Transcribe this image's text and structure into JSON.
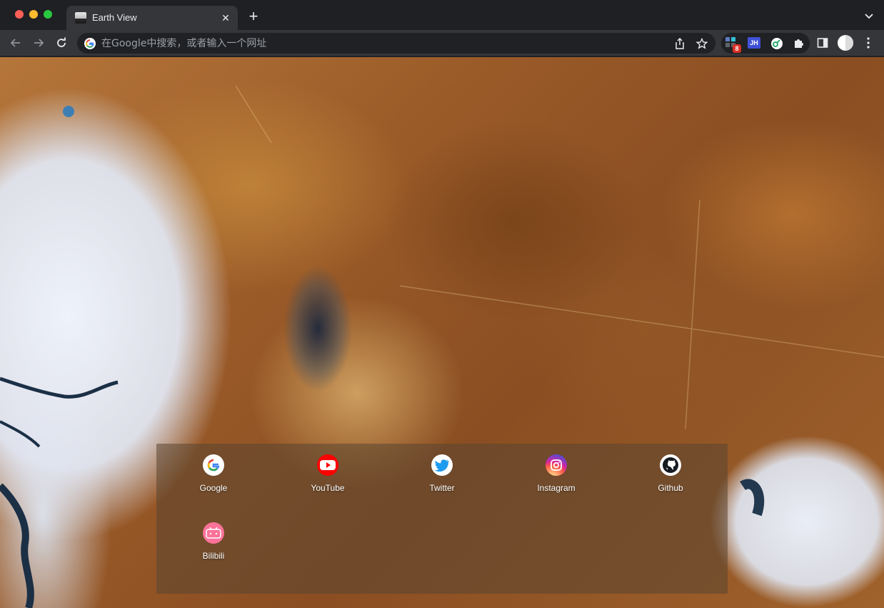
{
  "browser": {
    "tab": {
      "title": "Earth View",
      "favicon": "earth-view-favicon"
    },
    "omnibox": {
      "placeholder": "在Google中搜索，或者输入一个网址"
    },
    "extensions": {
      "badge_count": "8",
      "jh_label": "JH"
    }
  },
  "speed_dial": {
    "items": [
      {
        "label": "Google",
        "icon": "google-icon"
      },
      {
        "label": "YouTube",
        "icon": "youtube-icon"
      },
      {
        "label": "Twitter",
        "icon": "twitter-icon"
      },
      {
        "label": "Instagram",
        "icon": "instagram-icon"
      },
      {
        "label": "Github",
        "icon": "github-icon"
      },
      {
        "label": "Bilibili",
        "icon": "bilibili-icon"
      }
    ]
  },
  "colors": {
    "chrome_dark": "#35363a",
    "tabstrip": "#1f2023",
    "youtube_red": "#ff0000",
    "twitter_blue": "#1d9bf0"
  }
}
